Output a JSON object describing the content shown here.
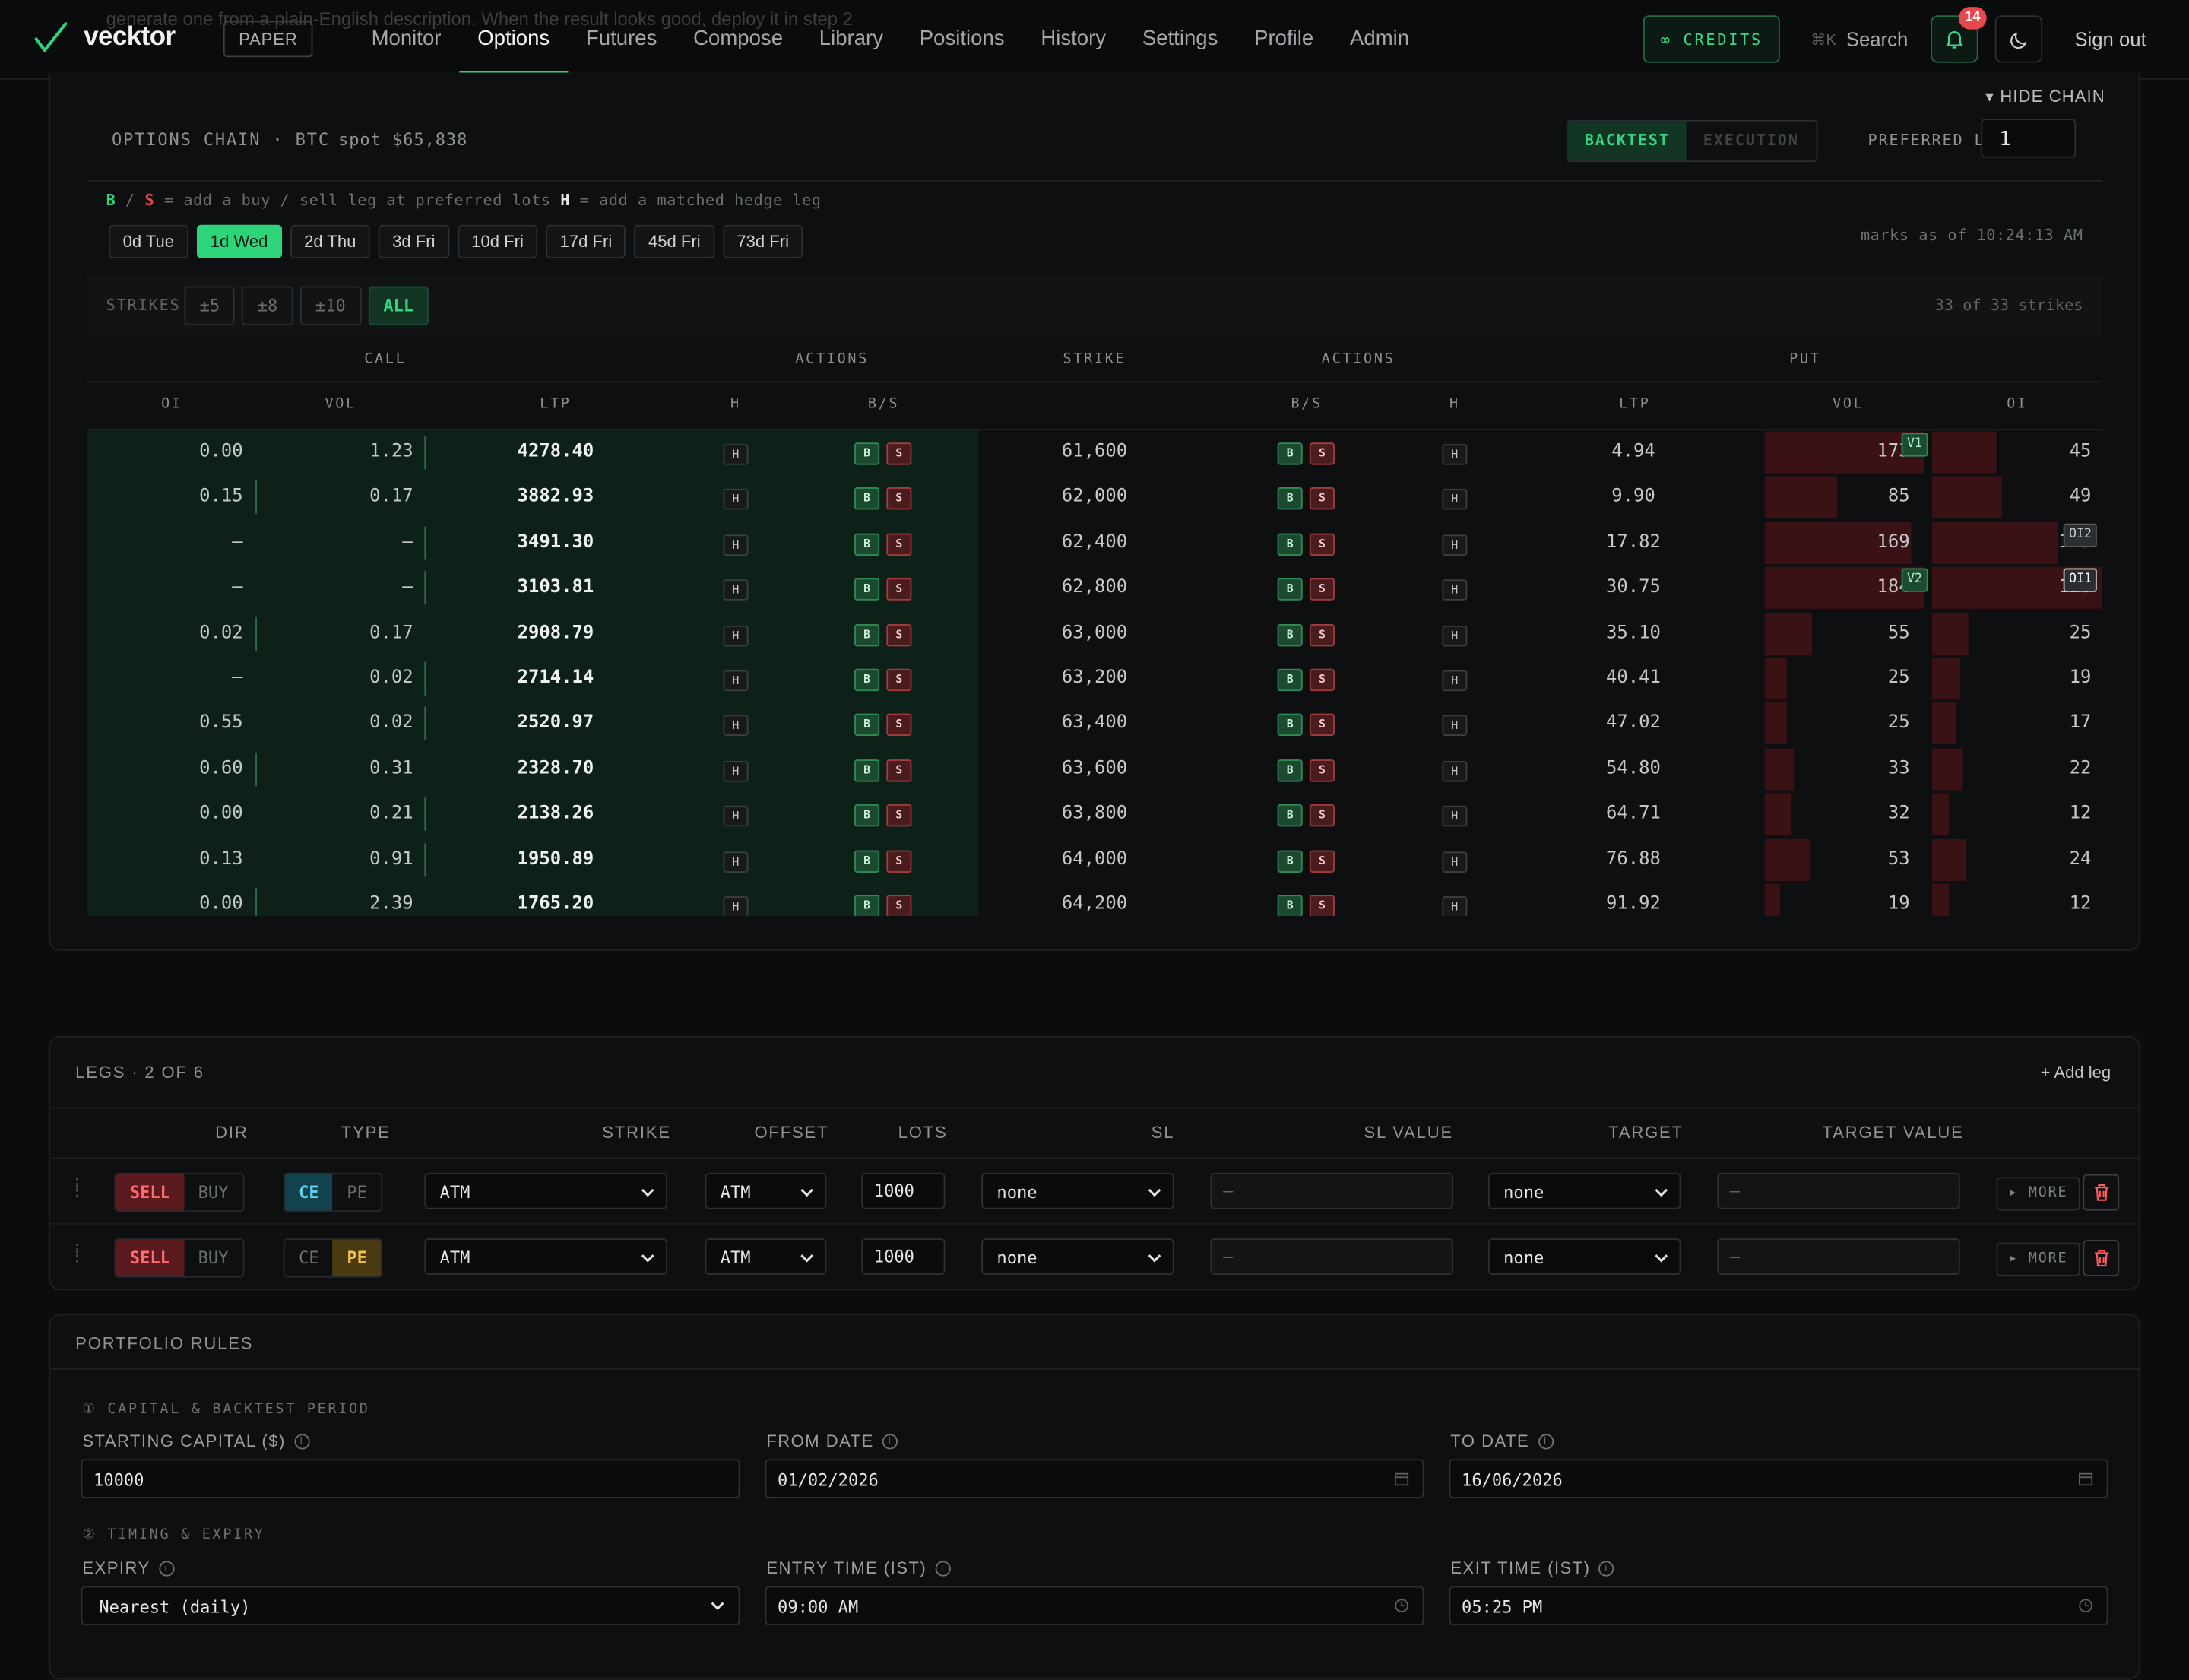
{
  "nav": {
    "brand": "vecktor",
    "mode_badge": "PAPER",
    "ghost_text": "generate one from a plain-English description. When the result looks good, deploy it in step 2",
    "links": [
      {
        "label": "Monitor"
      },
      {
        "label": "Options",
        "active": true
      },
      {
        "label": "Futures"
      },
      {
        "label": "Compose"
      },
      {
        "label": "Library"
      },
      {
        "label": "Positions"
      },
      {
        "label": "History"
      },
      {
        "label": "Settings"
      },
      {
        "label": "Profile"
      },
      {
        "label": "Admin"
      }
    ],
    "credits": "∞ CREDITS",
    "search_kbd": "⌘K",
    "search_label": "Search",
    "notif_count": "14",
    "signout": "Sign out"
  },
  "chain": {
    "hide_label": "HIDE CHAIN",
    "title": "OPTIONS CHAIN · BTC",
    "spot": "spot $65,838",
    "mode_backtest": "BACKTEST",
    "mode_execution": "EXECUTION",
    "pref_lots_label": "PREFERRED LOTS",
    "pref_lots_value": "1",
    "hint_b": "B",
    "hint_slash": " / ",
    "hint_s": "S",
    "hint_text1": " = add a buy / sell leg at preferred lots  ",
    "hint_h": "H",
    "hint_text2": " = add a matched hedge leg",
    "expiries": [
      {
        "label": "0d Tue"
      },
      {
        "label": "1d Wed",
        "active": true
      },
      {
        "label": "2d Thu"
      },
      {
        "label": "3d Fri"
      },
      {
        "label": "10d Fri"
      },
      {
        "label": "17d Fri"
      },
      {
        "label": "45d Fri"
      },
      {
        "label": "73d Fri"
      }
    ],
    "marks_asof": "marks as of 10:24:13 AM",
    "strikes_label": "STRIKES",
    "strike_filters": [
      {
        "label": "±5"
      },
      {
        "label": "±8"
      },
      {
        "label": "±10"
      },
      {
        "label": "ALL",
        "active": true
      }
    ],
    "strike_count": "33 of 33 strikes",
    "groups": {
      "call": "CALL",
      "actions": "ACTIONS",
      "strike": "STRIKE",
      "put": "PUT"
    },
    "columns": {
      "oi": "OI",
      "vol": "VOL",
      "ltp": "LTP",
      "h": "H",
      "bs": "B/S"
    },
    "btn_h": "H",
    "btn_b": "B",
    "btn_s": "S",
    "tags": {
      "v1": "V1",
      "v2": "V2",
      "oi1": "OI1",
      "oi2": "OI2"
    },
    "rows": [
      {
        "call_oi": "0.00",
        "call_vol": "1.23",
        "call_ltp": "4278.40",
        "strike": "61,600",
        "put_ltp": "4.94",
        "put_vol": "173",
        "put_oi": "45",
        "put_vol_frac": 1.0,
        "put_oi_frac": 0.38
      },
      {
        "call_oi": "0.15",
        "call_vol": "0.17",
        "call_ltp": "3882.93",
        "strike": "62,000",
        "put_ltp": "9.90",
        "put_vol": "85",
        "put_oi": "49",
        "put_vol_frac": 0.46,
        "put_oi_frac": 0.41
      },
      {
        "call_oi": "—",
        "call_vol": "—",
        "call_ltp": "3491.30",
        "strike": "62,400",
        "put_ltp": "17.82",
        "put_vol": "169",
        "put_oi": "113",
        "put_vol_frac": 0.92,
        "put_oi_frac": 0.74
      },
      {
        "call_oi": "—",
        "call_vol": "—",
        "call_ltp": "3103.81",
        "strike": "62,800",
        "put_ltp": "30.75",
        "put_vol": "184",
        "put_oi": "120",
        "put_vol_frac": 1.0,
        "put_oi_frac": 1.0
      },
      {
        "call_oi": "0.02",
        "call_vol": "0.17",
        "call_ltp": "2908.79",
        "strike": "63,000",
        "put_ltp": "35.10",
        "put_vol": "55",
        "put_oi": "25",
        "put_vol_frac": 0.3,
        "put_oi_frac": 0.21
      },
      {
        "call_oi": "—",
        "call_vol": "0.02",
        "call_ltp": "2714.14",
        "strike": "63,200",
        "put_ltp": "40.41",
        "put_vol": "25",
        "put_oi": "19",
        "put_vol_frac": 0.14,
        "put_oi_frac": 0.16
      },
      {
        "call_oi": "0.55",
        "call_vol": "0.02",
        "call_ltp": "2520.97",
        "strike": "63,400",
        "put_ltp": "47.02",
        "put_vol": "25",
        "put_oi": "17",
        "put_vol_frac": 0.14,
        "put_oi_frac": 0.14
      },
      {
        "call_oi": "0.60",
        "call_vol": "0.31",
        "call_ltp": "2328.70",
        "strike": "63,600",
        "put_ltp": "54.80",
        "put_vol": "33",
        "put_oi": "22",
        "put_vol_frac": 0.18,
        "put_oi_frac": 0.18
      },
      {
        "call_oi": "0.00",
        "call_vol": "0.21",
        "call_ltp": "2138.26",
        "strike": "63,800",
        "put_ltp": "64.71",
        "put_vol": "32",
        "put_oi": "12",
        "put_vol_frac": 0.17,
        "put_oi_frac": 0.1
      },
      {
        "call_oi": "0.13",
        "call_vol": "0.91",
        "call_ltp": "1950.89",
        "strike": "64,000",
        "put_ltp": "76.88",
        "put_vol": "53",
        "put_oi": "24",
        "put_vol_frac": 0.29,
        "put_oi_frac": 0.2
      },
      {
        "call_oi": "0.00",
        "call_vol": "2.39",
        "call_ltp": "1765.20",
        "strike": "64,200",
        "put_ltp": "91.92",
        "put_vol": "19",
        "put_oi": "12",
        "put_vol_frac": 0.1,
        "put_oi_frac": 0.1
      }
    ]
  },
  "legs": {
    "title": "LEGS · 2 OF 6",
    "add_leg": "+ Add leg",
    "headers": {
      "dir": "DIR",
      "type": "TYPE",
      "strike": "STRIKE",
      "offset": "OFFSET",
      "lots": "LOTS",
      "sl": "SL",
      "sl_value": "SL VALUE",
      "target": "TARGET",
      "target_value": "TARGET VALUE"
    },
    "dir_sell": "SELL",
    "dir_buy": "BUY",
    "type_ce": "CE",
    "type_pe": "PE",
    "more": "▸ MORE",
    "rows": [
      {
        "dir": "SELL",
        "type": "CE",
        "strike": "ATM",
        "offset": "ATM",
        "lots": "1000",
        "sl": "none",
        "sl_value": "—",
        "target": "none",
        "target_value": "—"
      },
      {
        "dir": "SELL",
        "type": "PE",
        "strike": "ATM",
        "offset": "ATM",
        "lots": "1000",
        "sl": "none",
        "sl_value": "—",
        "target": "none",
        "target_value": "—"
      }
    ]
  },
  "portfolio": {
    "title": "PORTFOLIO RULES",
    "section1": "① CAPITAL & BACKTEST PERIOD",
    "capital_label": "STARTING CAPITAL ($)",
    "capital_value": "10000",
    "from_label": "FROM DATE",
    "from_value": "01/02/2026",
    "to_label": "TO DATE",
    "to_value": "16/06/2026",
    "section2": "② TIMING & EXPIRY",
    "expiry_label": "EXPIRY",
    "expiry_value": "Nearest (daily)",
    "entry_label": "ENTRY TIME (IST)",
    "entry_value": "09:00 AM",
    "exit_label": "EXIT TIME (IST)",
    "exit_value": "05:25 PM"
  }
}
